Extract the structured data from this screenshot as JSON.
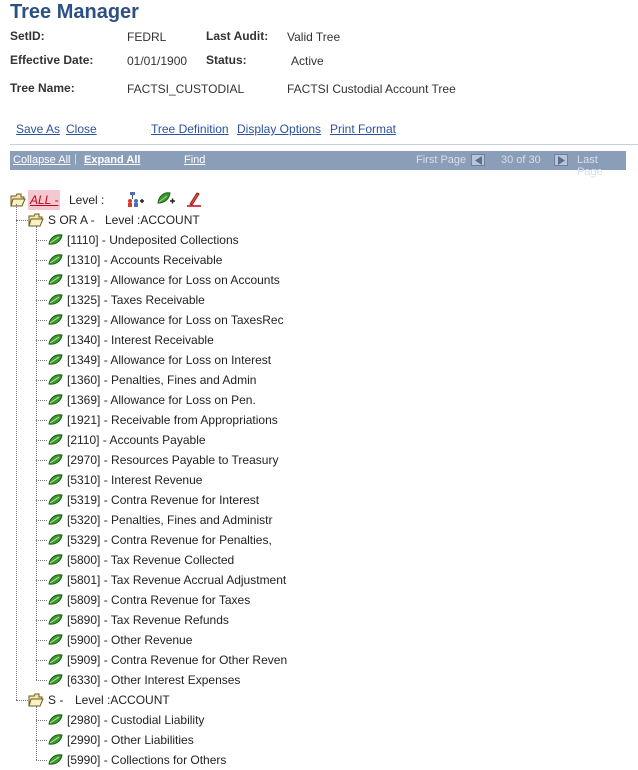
{
  "header": {
    "title": "Tree Manager",
    "setid_label": "SetID:",
    "setid_value": "FEDRL",
    "last_audit_label": "Last Audit:",
    "last_audit_value": "Valid Tree",
    "effdate_label": "Effective Date:",
    "effdate_value": "01/01/1900",
    "status_label": "Status:",
    "status_value": "Active",
    "treename_label": "Tree Name:",
    "treename_value": "FACTSI_CUSTODIAL",
    "tree_desc": "FACTSI Custodial Account Tree"
  },
  "actions": {
    "save_as": "Save As",
    "close": "Close",
    "tree_definition": "Tree Definition",
    "display_options": "Display Options",
    "print_format": "Print Format"
  },
  "navbar": {
    "collapse_all": "Collapse All",
    "separator": "|",
    "expand_all": "Expand All",
    "find": "Find",
    "first_page": "First Page",
    "page_info": "30 of 30",
    "last_page": "Last Page"
  },
  "tree": {
    "root_label": "ALL -",
    "root_level": "Level :",
    "groups": [
      {
        "label": "S OR A -",
        "level": "Level :ACCOUNT",
        "items": [
          "[1110] - Undeposited Collections",
          "[1310] - Accounts Receivable",
          "[1319] - Allowance for Loss on Accounts",
          "[1325] - Taxes Receivable",
          "[1329] - Allowance for Loss on TaxesRec",
          "[1340] - Interest Receivable",
          "[1349] - Allowance for Loss on Interest",
          "[1360] - Penalties, Fines and Admin",
          "[1369] - Allowance for Loss on Pen.",
          "[1921] - Receivable from Appropriations",
          "[2110] - Accounts Payable",
          "[2970] - Resources Payable to Treasury",
          "[5310] - Interest Revenue",
          "[5319] - Contra Revenue for Interest",
          "[5320] - Penalties, Fines and Administr",
          "[5329] - Contra Revenue for Penalties,",
          "[5800] - Tax Revenue Collected",
          "[5801] - Tax Revenue Accrual Adjustment",
          "[5809] - Contra Revenue for Taxes",
          "[5890] - Tax Revenue Refunds",
          "[5900] - Other Revenue",
          "[5909] - Contra Revenue for Other Reven",
          "[6330] - Other Interest Expenses"
        ]
      },
      {
        "label": "S -",
        "level": "Level :ACCOUNT",
        "items": [
          "[2980] - Custodial Liability",
          "[2990] - Other Liabilities",
          "[5990] - Collections for Others"
        ]
      }
    ]
  },
  "colors": {
    "title": "#2d4f84",
    "link": "#2a52a0",
    "navbar": "#8a9db9",
    "leaf_green": "#3a9a2a",
    "root_red": "#c8001c"
  }
}
